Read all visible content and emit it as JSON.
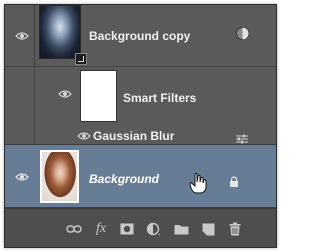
{
  "layers": [
    {
      "name": "Background copy",
      "visible": true,
      "type": "smart-object"
    },
    {
      "name": "Smart Filters",
      "visible": true,
      "type": "smart-filters"
    },
    {
      "name": "Gaussian Blur",
      "visible": true,
      "type": "filter"
    },
    {
      "name": "Background",
      "visible": true,
      "type": "background",
      "selected": true,
      "locked": true
    }
  ],
  "toolbar": {
    "icons": [
      "link-layers-icon",
      "fx-icon",
      "add-mask-icon",
      "adjustment-layer-icon",
      "new-group-icon",
      "new-layer-icon",
      "delete-layer-icon"
    ],
    "fx_label": "fx"
  },
  "colors": {
    "panel": "#5a5a5a",
    "selected_row": "#667d95",
    "toolbar": "#4e4e4e"
  }
}
